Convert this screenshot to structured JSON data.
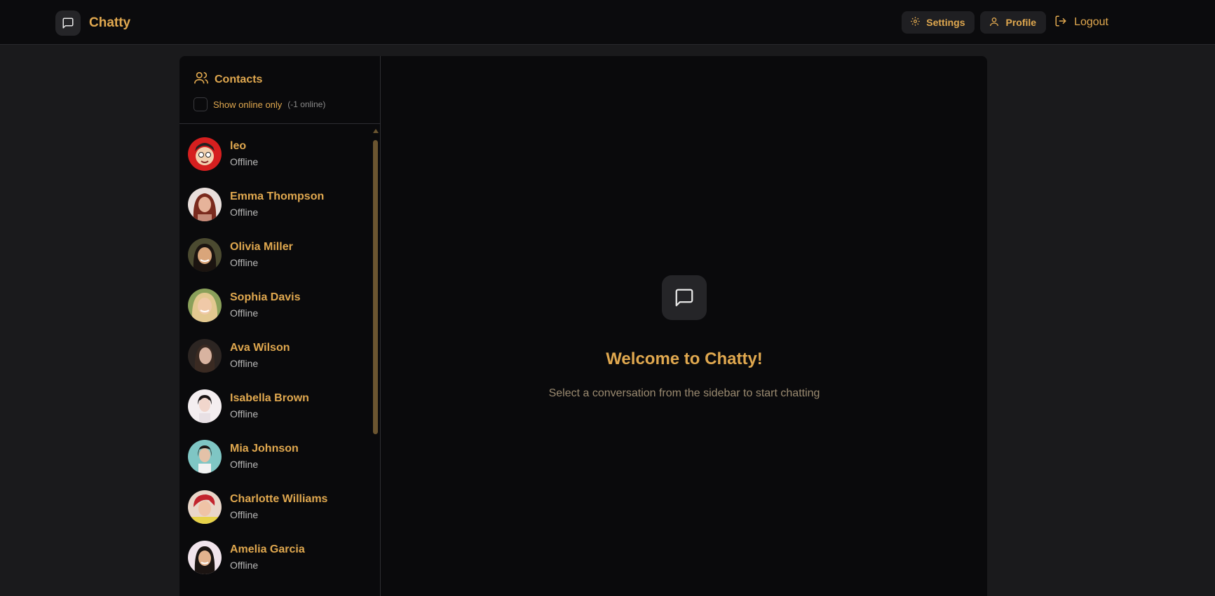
{
  "app": {
    "name": "Chatty"
  },
  "nav": {
    "settings": "Settings",
    "profile": "Profile",
    "logout": "Logout"
  },
  "sidebar": {
    "title": "Contacts",
    "filter_label": "Show online only",
    "online_count": "(-1 online)",
    "contacts": [
      {
        "name": "leo",
        "status": "Offline"
      },
      {
        "name": "Emma Thompson",
        "status": "Offline"
      },
      {
        "name": "Olivia Miller",
        "status": "Offline"
      },
      {
        "name": "Sophia Davis",
        "status": "Offline"
      },
      {
        "name": "Ava Wilson",
        "status": "Offline"
      },
      {
        "name": "Isabella Brown",
        "status": "Offline"
      },
      {
        "name": "Mia Johnson",
        "status": "Offline"
      },
      {
        "name": "Charlotte Williams",
        "status": "Offline"
      },
      {
        "name": "Amelia Garcia",
        "status": "Offline"
      }
    ]
  },
  "main": {
    "welcome_title": "Welcome to Chatty!",
    "welcome_subtitle": "Select a conversation from the sidebar to start chatting"
  },
  "colors": {
    "accent": "#e0a84f",
    "background": "#1a1a1c",
    "panel": "#0a0a0c"
  }
}
